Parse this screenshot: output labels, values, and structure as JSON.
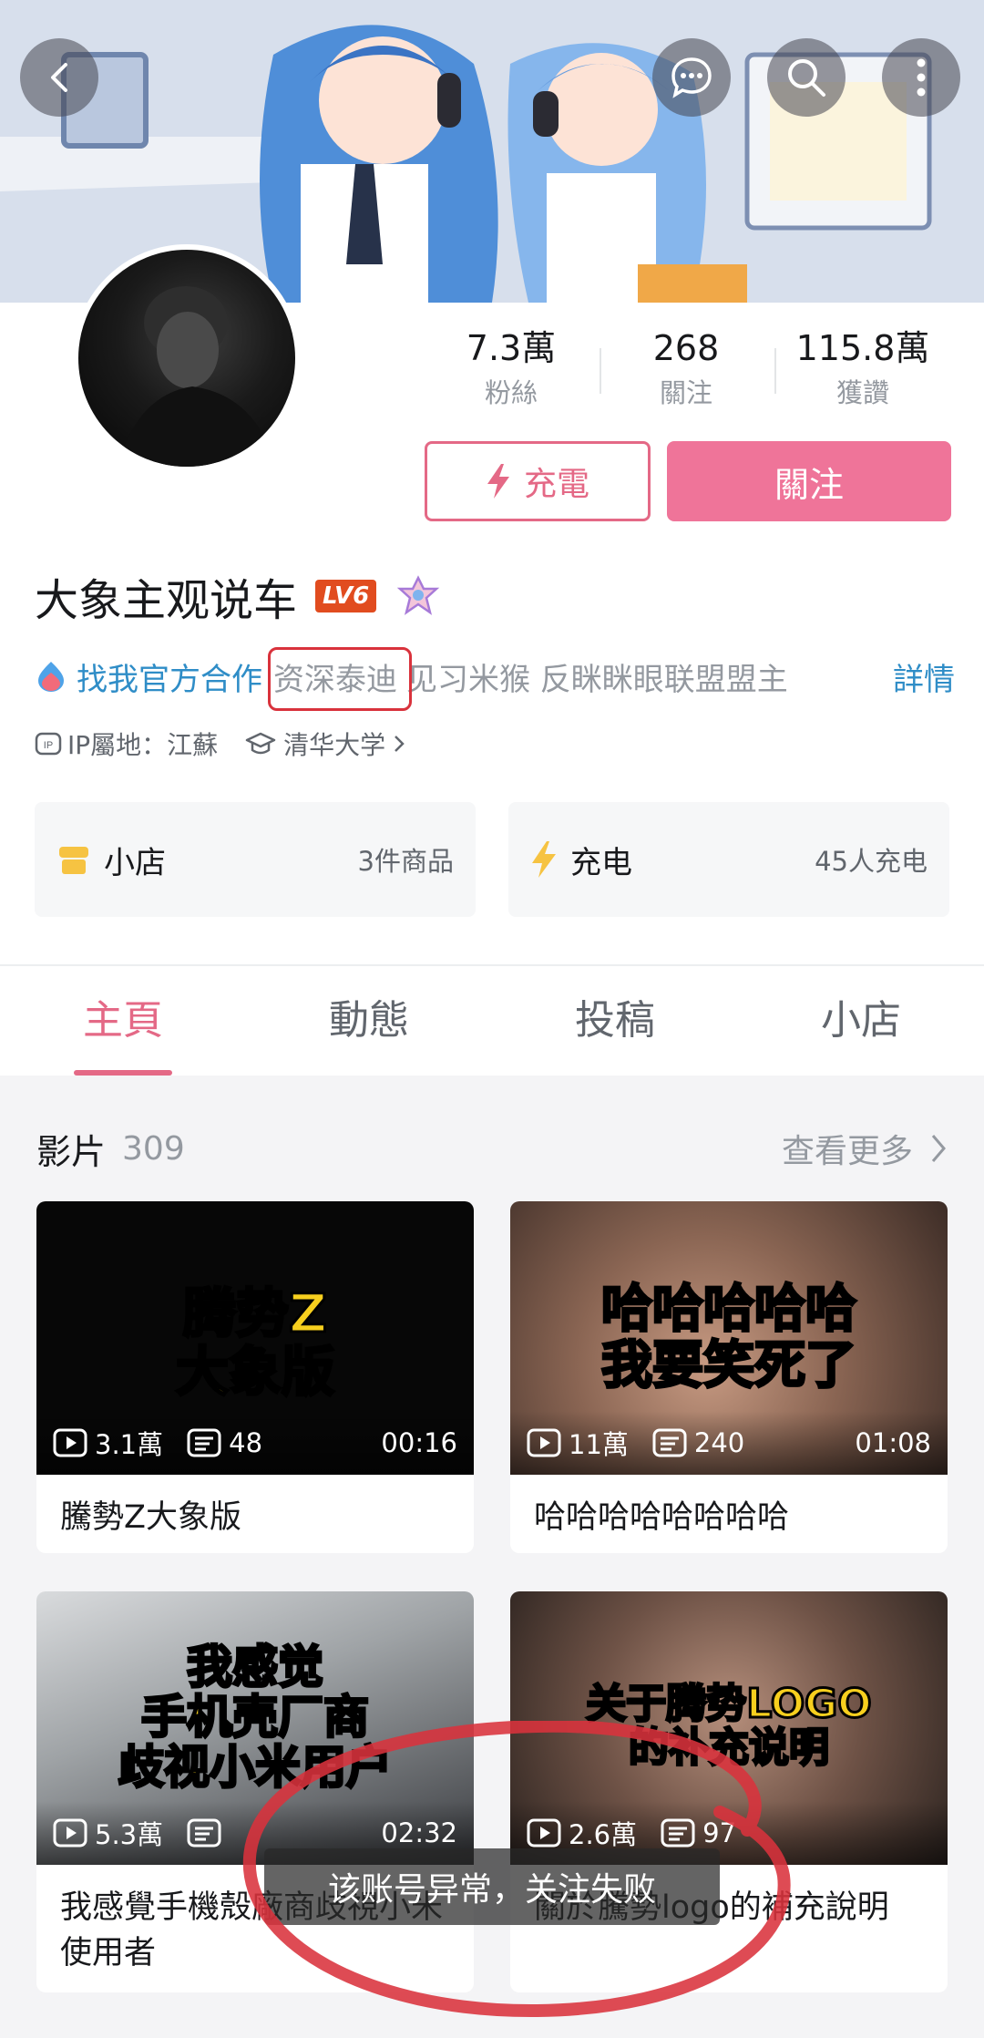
{
  "header": {
    "back": "back-icon",
    "icons": [
      "chat-icon",
      "search-icon",
      "more-icon"
    ]
  },
  "stats": [
    {
      "value": "7.3萬",
      "label": "粉絲"
    },
    {
      "value": "268",
      "label": "關注"
    },
    {
      "value": "115.8萬",
      "label": "獲讚"
    }
  ],
  "actions": {
    "charge": "充電",
    "follow": "關注"
  },
  "user": {
    "name": "大象主观说车",
    "level": "LV6",
    "official": "找我官方合作",
    "tag1": "资深泰迪",
    "tag2": "见习米猴 反眯眯眼联盟盟主",
    "detail": "詳情",
    "ip": "IP屬地：江蘇",
    "school": "清华大学"
  },
  "cards": {
    "shop": {
      "title": "小店",
      "sub": "3件商品"
    },
    "charge": {
      "title": "充电",
      "sub": "45人充电"
    }
  },
  "tabs": [
    "主頁",
    "動態",
    "投稿",
    "小店"
  ],
  "videos_section": {
    "title": "影片",
    "count": "309",
    "more": "查看更多"
  },
  "videos": [
    {
      "thumb_text": "腾势Z\n大象版",
      "plays": "3.1萬",
      "comments": "48",
      "duration": "00:16",
      "title": "騰勢Z大象版"
    },
    {
      "thumb_text": "哈哈哈哈哈\n我要笑死了",
      "plays": "11萬",
      "comments": "240",
      "duration": "01:08",
      "title": "哈哈哈哈哈哈哈哈"
    },
    {
      "thumb_text": "我感觉\n手机壳厂商\n歧视小米用户",
      "plays": "5.3萬",
      "comments": "",
      "duration": "02:32",
      "title": "我感覺手機殼廠商歧視小米使用者"
    },
    {
      "thumb_text": "关于腾势LOGO\n的补充说明",
      "plays": "2.6萬",
      "comments": "97",
      "duration": "",
      "title": "關於騰勢logo的補充說明"
    }
  ],
  "toast": "该账号异常，关注失败",
  "colors": {
    "accent": "#e46986",
    "follow_bg": "#ef7499",
    "link": "#2f8dc7",
    "annotation": "#d9323c"
  }
}
